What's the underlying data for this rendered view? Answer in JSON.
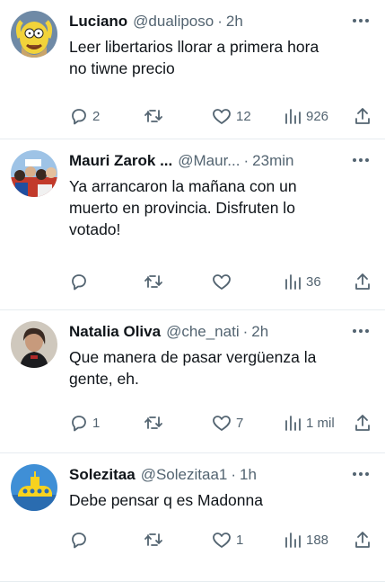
{
  "tweets": [
    {
      "name": "Luciano",
      "handle": "@dualiposo",
      "time": "2h",
      "text": "Leer libertarios llorar a primera hora\nno tiwne precio",
      "replies": "2",
      "retweets": "",
      "likes": "12",
      "views": "926",
      "avatar_icon": "homer-avatar-icon"
    },
    {
      "name": "Mauri Zarok ...",
      "handle": "@Maur...",
      "time": "23min",
      "text": "Ya arrancaron la mañana con un\nmuerto en provincia. Disfruten lo\nvotado!",
      "replies": "",
      "retweets": "",
      "likes": "",
      "views": "36",
      "avatar_icon": "crowd-avatar-icon"
    },
    {
      "name": "Natalia Oliva",
      "handle": "@che_nati",
      "time": "2h",
      "text": "Que manera de pasar vergüenza la\ngente, eh.",
      "replies": "1",
      "retweets": "",
      "likes": "7",
      "views": "1 mil",
      "avatar_icon": "person-avatar-icon"
    },
    {
      "name": "Solezitaa",
      "handle": "@Solezitaa1",
      "time": "1h",
      "text": "Debe pensar q es Madonna",
      "replies": "",
      "retweets": "",
      "likes": "1",
      "views": "188",
      "avatar_icon": "submarine-avatar-icon"
    }
  ],
  "separator": "·",
  "colors": {
    "text": "#0f1419",
    "muted": "#536471",
    "border": "#e6ecf0"
  }
}
